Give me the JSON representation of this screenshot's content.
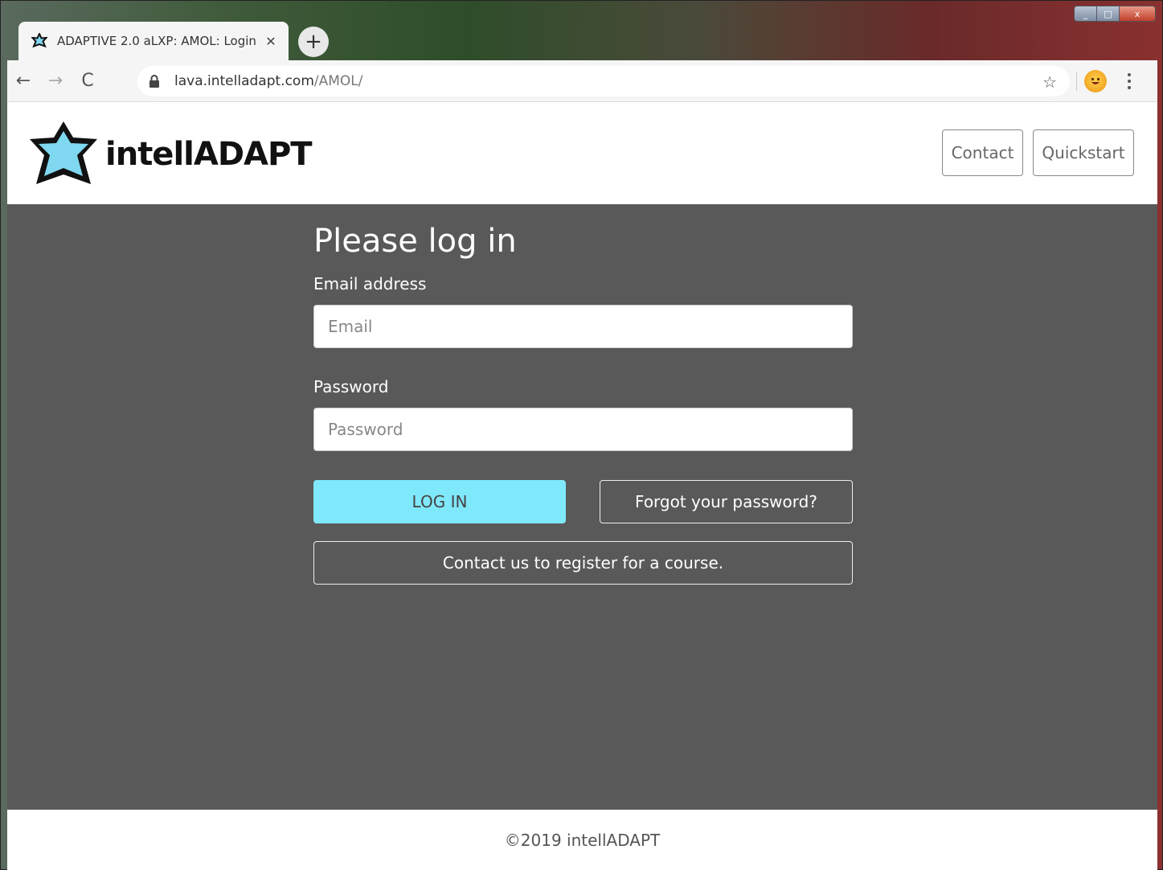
{
  "browser": {
    "tab_title": "ADAPTIVE 2.0 aLXP: AMOL: Login",
    "tab_close": "✕",
    "new_tab": "+",
    "url_host": "lava.intelladapt.com",
    "url_path": "/AMOL/",
    "back": "←",
    "forward": "→",
    "reload": "C",
    "bookmark": "☆",
    "window_controls": {
      "minimize": "_",
      "maximize": "□",
      "close": "x"
    }
  },
  "header": {
    "logo_text": "intellADAPT",
    "contact_label": "Contact",
    "quickstart_label": "Quickstart"
  },
  "form": {
    "title": "Please log in",
    "email_label": "Email address",
    "email_placeholder": "Email",
    "password_label": "Password",
    "password_placeholder": "Password",
    "login_label": "LOG IN",
    "forgot_label": "Forgot your password?",
    "register_label": "Contact us to register for a course."
  },
  "footer": {
    "copyright": "©2019 intellADAPT"
  },
  "colors": {
    "content_bg": "#595959",
    "login_button": "#80e8fb",
    "logo_star_fill": "#7fd8ef"
  }
}
